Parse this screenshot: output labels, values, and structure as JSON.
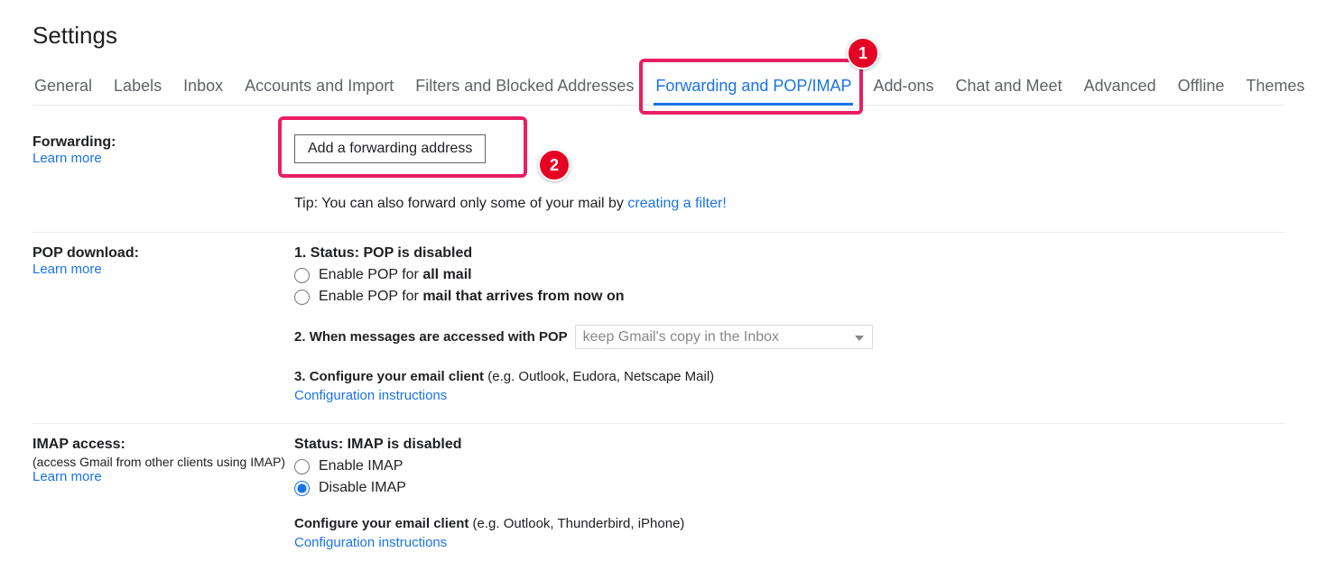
{
  "page": {
    "title": "Settings"
  },
  "tabs": {
    "general": "General",
    "labels": "Labels",
    "inbox": "Inbox",
    "accounts": "Accounts and Import",
    "filters": "Filters and Blocked Addresses",
    "forwarding": "Forwarding and POP/IMAP",
    "addons": "Add-ons",
    "chat": "Chat and Meet",
    "advanced": "Advanced",
    "offline": "Offline",
    "themes": "Themes"
  },
  "forwarding": {
    "title": "Forwarding:",
    "learn_more": "Learn more",
    "button": "Add a forwarding address",
    "tip_prefix": "Tip: You can also forward only some of your mail by ",
    "tip_link": "creating a filter!"
  },
  "pop": {
    "title": "POP download:",
    "learn_more": "Learn more",
    "status_num": "1. ",
    "status_label": "Status: ",
    "status_value": "POP is disabled",
    "enable_all_prefix": "Enable POP for ",
    "enable_all_bold": "all mail",
    "enable_now_prefix": "Enable POP for ",
    "enable_now_bold": "mail that arrives from now on",
    "when_num": "2. ",
    "when_label": "When messages are accessed with POP",
    "when_select": "keep Gmail's copy in the Inbox",
    "configure_num": "3. ",
    "configure_bold": "Configure your email client",
    "configure_rest": " (e.g. Outlook, Eudora, Netscape Mail)",
    "config_link": "Configuration instructions"
  },
  "imap": {
    "title": "IMAP access:",
    "subtitle": "(access Gmail from other clients using IMAP)",
    "learn_more": "Learn more",
    "status_label": "Status: ",
    "status_value": "IMAP is disabled",
    "enable": "Enable IMAP",
    "disable": "Disable IMAP",
    "configure_bold": "Configure your email client",
    "configure_rest": " (e.g. Outlook, Thunderbird, iPhone)",
    "config_link": "Configuration instructions"
  },
  "annotations": {
    "circle1": "1",
    "circle2": "2"
  }
}
